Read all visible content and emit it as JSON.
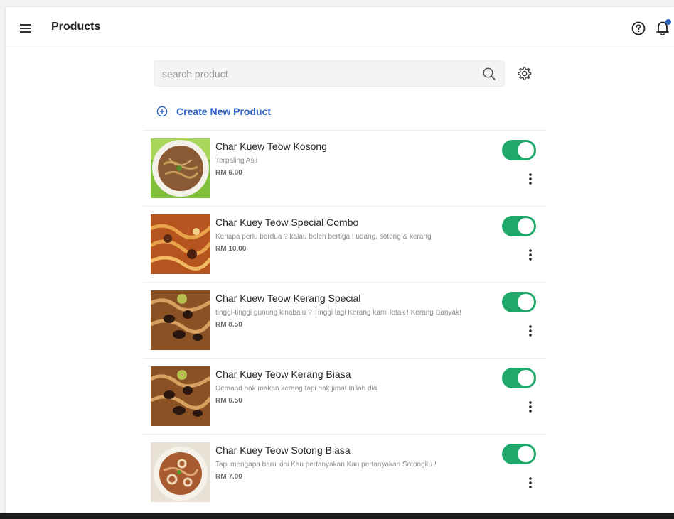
{
  "header": {
    "title": "Products",
    "menu_icon": "hamburger-menu-icon",
    "help_icon": "help-circle-icon",
    "notification_icon": "bell-icon",
    "notification_dot_color": "#2f64c6"
  },
  "search": {
    "placeholder": "search product",
    "value": "",
    "icon": "search-icon",
    "settings_icon": "gear-icon"
  },
  "create": {
    "label": "Create New Product",
    "icon": "plus-circle-icon",
    "color": "#2f64c6"
  },
  "toggle_color": "#1fa86a",
  "products": [
    {
      "name": "Char Kuew Teow Kosong",
      "description": "Terpaling Asli",
      "price": "RM 6.00",
      "enabled": true
    },
    {
      "name": "Char Kuey Teow Special Combo",
      "description": "Kenapa perlu berdua ? kalau boleh bertiga ! udang, sotong & kerang",
      "price": "RM 10.00",
      "enabled": true
    },
    {
      "name": "Char Kuew Teow Kerang Special",
      "description": "tinggi-tinggi gunung kinabalu ? Tinggi lagi Kerang kami letak ! Kerang Banyak!",
      "price": "RM 8.50",
      "enabled": true
    },
    {
      "name": "Char Kuey Teow Kerang Biasa",
      "description": "Demand nak makan kerang tapi nak jimat Inilah dia !",
      "price": "RM 6.50",
      "enabled": true
    },
    {
      "name": "Char Kuey Teow Sotong Biasa",
      "description": "Tapi mengapa baru kini Kau pertanyakan Kau pertanyakan Sotongku !",
      "price": "RM 7.00",
      "enabled": true
    }
  ]
}
